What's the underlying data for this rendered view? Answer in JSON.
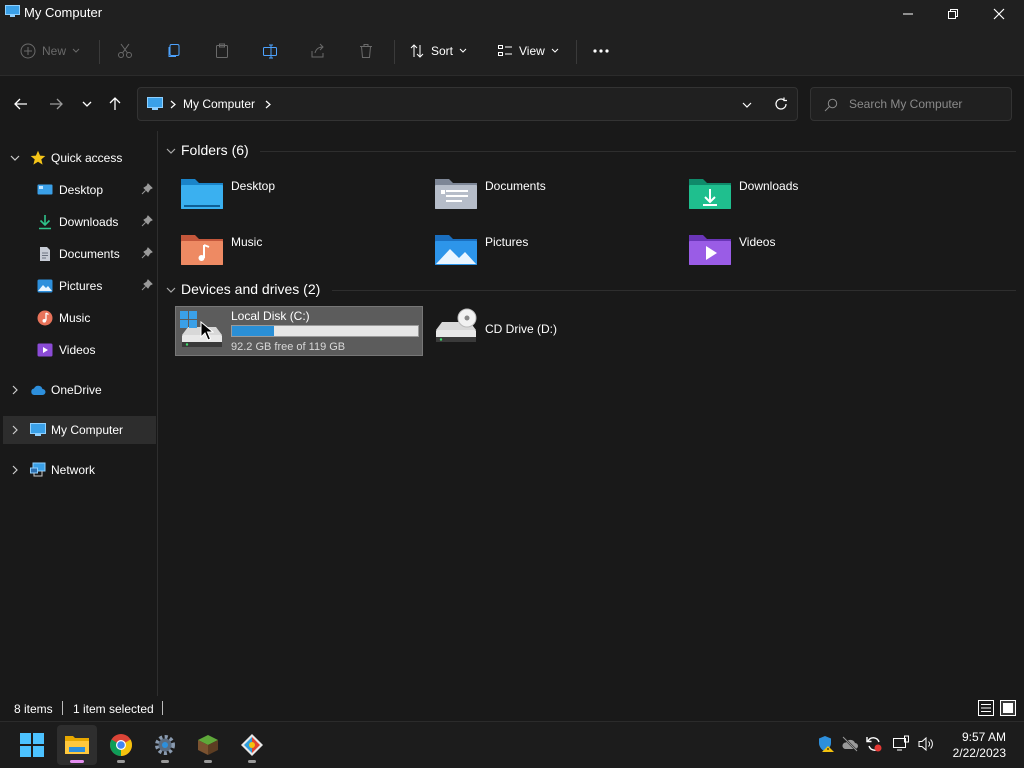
{
  "window": {
    "title": "My Computer"
  },
  "toolbar": {
    "new_label": "New",
    "sort_label": "Sort",
    "view_label": "View"
  },
  "address": {
    "path": "My Computer"
  },
  "search": {
    "placeholder": "Search My Computer"
  },
  "sidebar": {
    "quick_access": "Quick access",
    "items": [
      {
        "label": "Desktop"
      },
      {
        "label": "Downloads"
      },
      {
        "label": "Documents"
      },
      {
        "label": "Pictures"
      },
      {
        "label": "Music"
      },
      {
        "label": "Videos"
      }
    ],
    "onedrive": "OneDrive",
    "my_computer": "My Computer",
    "network": "Network"
  },
  "content": {
    "folders_header": "Folders (6)",
    "folders": [
      {
        "label": "Desktop"
      },
      {
        "label": "Documents"
      },
      {
        "label": "Downloads"
      },
      {
        "label": "Music"
      },
      {
        "label": "Pictures"
      },
      {
        "label": "Videos"
      }
    ],
    "drives_header": "Devices and drives (2)",
    "drives": [
      {
        "label": "Local Disk (C:)",
        "free_text": "92.2 GB free of 119 GB",
        "used_fraction": 0.225
      },
      {
        "label": "CD Drive (D:)"
      }
    ]
  },
  "status": {
    "items": "8 items",
    "selected": "1 item selected"
  },
  "taskbar": {
    "time": "9:57 AM",
    "date": "2/22/2023"
  },
  "colors": {
    "accent": "#2a8fd6",
    "window_bg": "#191919",
    "chrome_bg": "#202020",
    "selection_bg": "#5c5c5c"
  }
}
